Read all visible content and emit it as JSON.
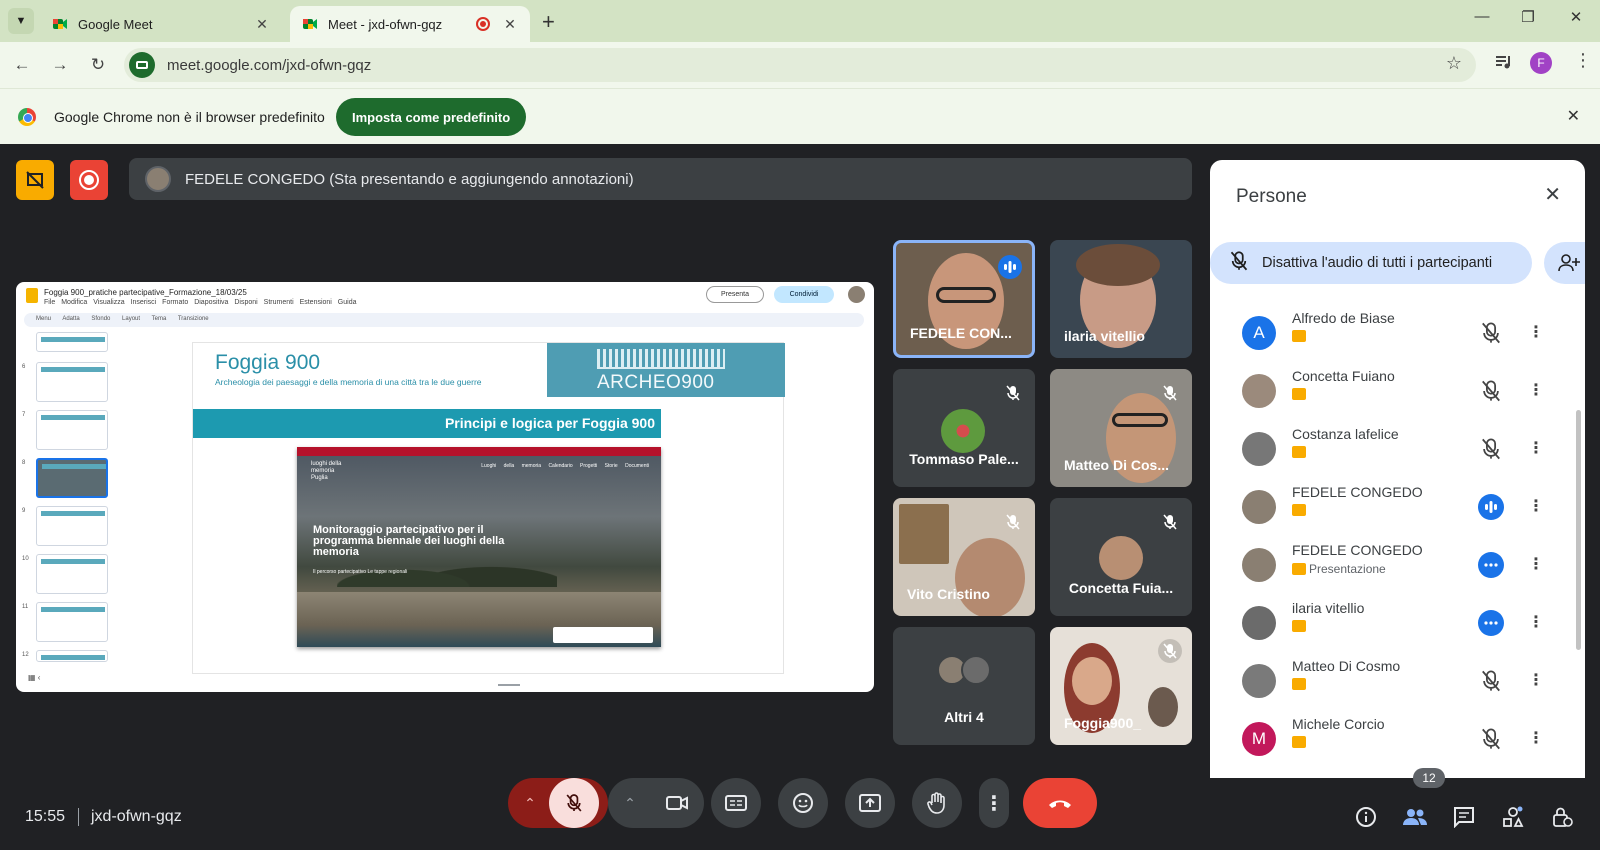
{
  "browser": {
    "tabs": [
      {
        "title": "Google Meet"
      },
      {
        "title": "Meet - jxd-ofwn-gqz"
      }
    ],
    "url": "meet.google.com/jxd-ofwn-gqz",
    "profile_initial": "F",
    "infobar": {
      "text": "Google Chrome non è il browser predefinito",
      "button": "Imposta come predefinito"
    }
  },
  "meet": {
    "presenter_text": "FEDELE CONGEDO (Sta presentando e aggiungendo annotazioni)",
    "slides": {
      "doc_title": "Foggia 900_pratiche partecipative_Formazione_18/03/25",
      "menu": "File Modifica Visualizza Inserisci Formato Diapositiva Disponi Strumenti Estensioni Guida",
      "toolbar": "Menu Adatta Sfondo Layout Tema Transizione",
      "present_btn": "Presenta",
      "share_btn": "Condividi",
      "thumb_numbers": [
        "6",
        "7",
        "8",
        "9",
        "10",
        "11",
        "12"
      ],
      "slide_title": "Foggia 900",
      "slide_subtitle": "Archeologia dei paesaggi e della memoria di una città tra le due guerre",
      "archeo_label": "ARCHEO900",
      "band": "Principi e logica per Foggia 900",
      "inner_brand": "luoghi della memoria Puglia",
      "inner_nav": "Luoghi della memoria  Calendario  Progetti  Storie  Documenti",
      "inner_heading": "Monitoraggio partecipativo per il programma biennale dei luoghi della memoria",
      "inner_sub": "Il percorso partecipativo   Le tappe regionali"
    },
    "tiles": [
      {
        "name": "FEDELE CON..."
      },
      {
        "name": "ilaria vitellio"
      },
      {
        "name": "Tommaso Pale..."
      },
      {
        "name": "Matteo Di Cos..."
      },
      {
        "name": "Vito Cristino"
      },
      {
        "name": "Concetta Fuia..."
      },
      {
        "name": "Altri 4"
      },
      {
        "name": "Foggia900_"
      }
    ],
    "people_panel": {
      "title": "Persone",
      "mute_all": "Disattiva l'audio di tutti i partecipanti",
      "people": [
        {
          "name": "Alfredo de Biase",
          "sub": "",
          "avatar_letter": "A",
          "avatar_color": "#1a73e8",
          "state": "muted"
        },
        {
          "name": "Concetta Fuiano",
          "sub": "",
          "avatar_letter": "",
          "avatar_color": "#9b8a7c",
          "state": "muted"
        },
        {
          "name": "Costanza lafelice",
          "sub": "",
          "avatar_letter": "",
          "avatar_color": "#777777",
          "state": "muted"
        },
        {
          "name": "FEDELE CONGEDO",
          "sub": "",
          "avatar_letter": "",
          "avatar_color": "#8a7f72",
          "state": "speaking"
        },
        {
          "name": "FEDELE CONGEDO",
          "sub": "Presentazione",
          "avatar_letter": "",
          "avatar_color": "#8a7f72",
          "state": "more"
        },
        {
          "name": "ilaria vitellio",
          "sub": "",
          "avatar_letter": "",
          "avatar_color": "#6b6b6b",
          "state": "more"
        },
        {
          "name": "Matteo Di Cosmo",
          "sub": "",
          "avatar_letter": "",
          "avatar_color": "#7a7a7a",
          "state": "muted"
        },
        {
          "name": "Michele Corcio",
          "sub": "",
          "avatar_letter": "M",
          "avatar_color": "#c2185b",
          "state": "muted"
        }
      ]
    },
    "bottom": {
      "time": "15:55",
      "meeting_code": "jxd-ofwn-gqz",
      "participant_count": "12"
    },
    "colors": {
      "end_call": "#ea4335",
      "mic_off": "#f9dedc",
      "accent_blue": "#1a73e8"
    }
  }
}
